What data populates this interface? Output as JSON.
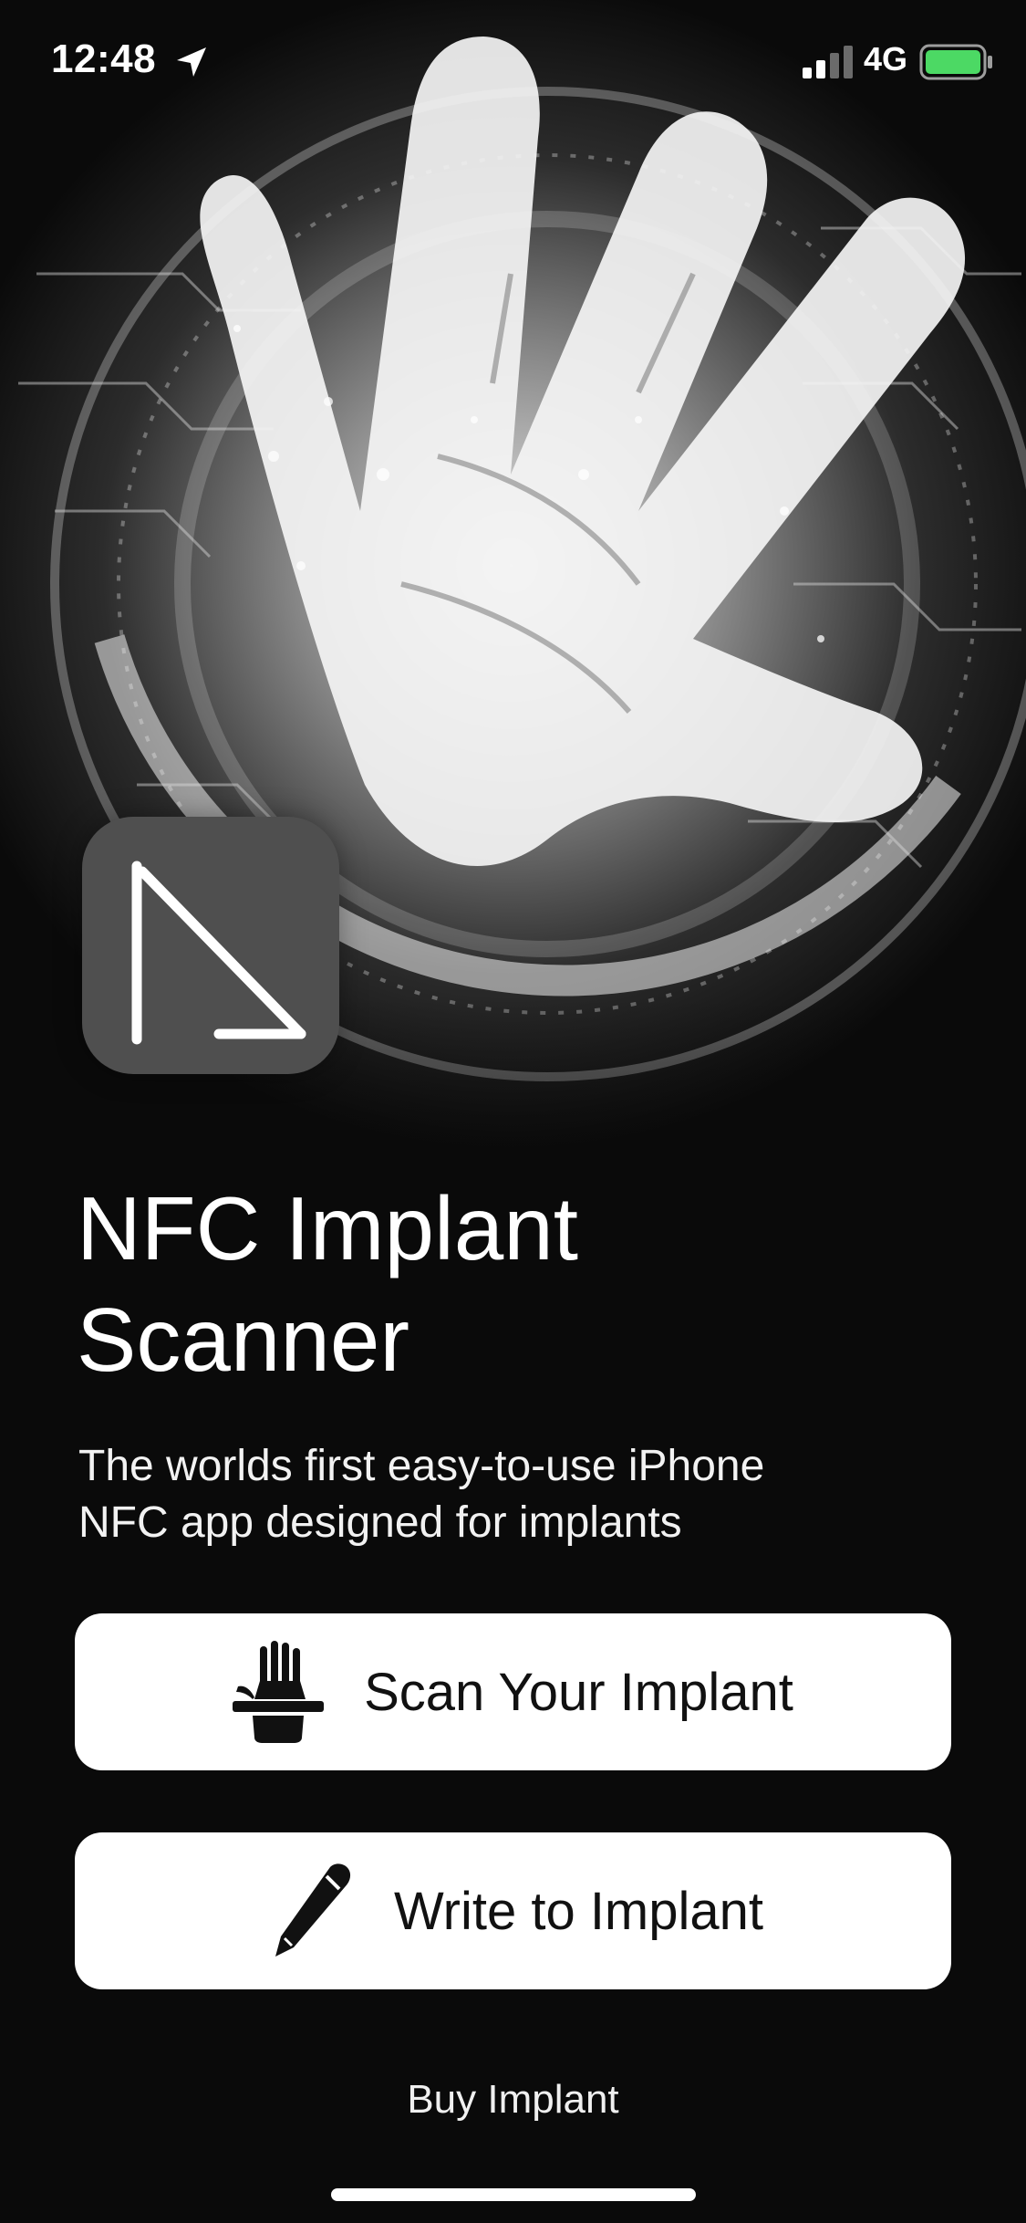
{
  "status_bar": {
    "time": "12:48",
    "network": "4G",
    "location_icon": "location-arrow-icon",
    "signal_icon": "cellular-signal-icon",
    "battery_icon": "battery-icon",
    "battery_color": "#4cd964"
  },
  "hero": {
    "image": "glowing-hand-circuit-illustration"
  },
  "app": {
    "icon": "nfc-app-logo",
    "title_line1": "NFC Implant",
    "title_line2": "Scanner",
    "subtitle_line1": "The worlds first easy-to-use iPhone",
    "subtitle_line2": "NFC app designed for implants"
  },
  "actions": {
    "scan": {
      "label": "Scan Your Implant",
      "icon": "hand-scan-icon"
    },
    "write": {
      "label": "Write to Implant",
      "icon": "pencil-icon"
    },
    "buy": {
      "label": "Buy Implant"
    }
  },
  "colors": {
    "background": "#0a0a0a",
    "button_background": "#ffffff",
    "button_text": "#111111",
    "app_icon_background": "#4f4f4f"
  }
}
